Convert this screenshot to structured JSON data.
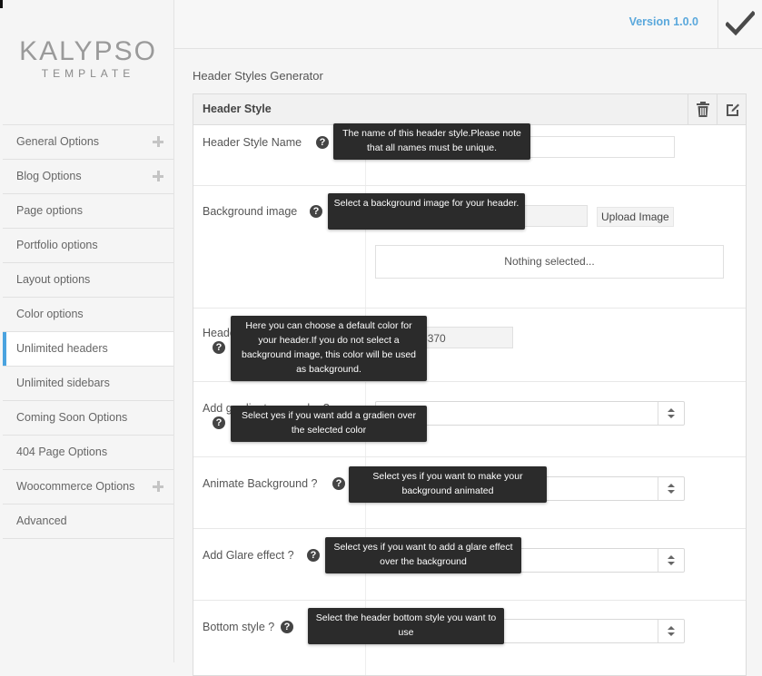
{
  "brand": {
    "name": "KALYPSO",
    "sub": "TEMPLATE"
  },
  "topbar": {
    "version": "Version 1.0.0"
  },
  "sidebar": {
    "items": [
      {
        "label": "General Options"
      },
      {
        "label": "Blog Options"
      },
      {
        "label": "Page options"
      },
      {
        "label": "Portfolio options"
      },
      {
        "label": "Layout options"
      },
      {
        "label": "Color options"
      },
      {
        "label": "Unlimited headers"
      },
      {
        "label": "Unlimited sidebars"
      },
      {
        "label": "Coming Soon Options"
      },
      {
        "label": "404 Page Options"
      },
      {
        "label": "Woocommerce Options"
      },
      {
        "label": "Advanced"
      }
    ]
  },
  "main": {
    "title": "Header Styles Generator",
    "panel_title": "Header Style",
    "fields": {
      "name": {
        "label": "Header Style Name",
        "value": "Header style with gradient",
        "tooltip": "The name of this header style.Please note that all names must be unique."
      },
      "bg_image": {
        "label": "Background image",
        "upload": "Upload Image",
        "nothing": "Nothing selected...",
        "tooltip": "Select a background image for your header."
      },
      "bg_color": {
        "label": "Header Background color",
        "value": "#345370",
        "tooltip": "Here you can choose a default color for your header.If you do not select a background image, this color will be used as background."
      },
      "gradient": {
        "label": "Add gradient over color ?",
        "value": "",
        "tooltip": "Select yes if you want add a gradien over the selected color"
      },
      "animate": {
        "label": "Animate Background ?",
        "value": "No",
        "tooltip": "Select yes if you want to make your background animated"
      },
      "glare": {
        "label": "Add Glare effect ?",
        "value": "",
        "tooltip": "Select yes if you want to add a glare effect over the background"
      },
      "bottom": {
        "label": "Bottom style ?",
        "value": "No",
        "tooltip": "Select the header bottom style you want to use"
      }
    }
  },
  "colors": {
    "accent": "#4aa3df",
    "swatch": "#345370"
  }
}
